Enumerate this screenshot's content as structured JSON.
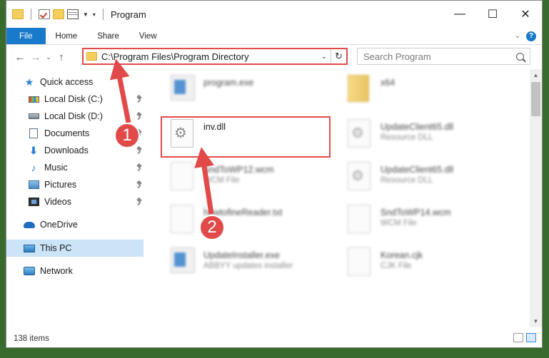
{
  "window": {
    "title": "Program",
    "controls": {
      "minimize": "—",
      "maximize": "☐",
      "close": "✕"
    }
  },
  "ribbon": {
    "tabs": [
      "File",
      "Home",
      "Share",
      "View"
    ],
    "help": "?"
  },
  "address": {
    "path": "C:\\Program Files\\Program Directory",
    "search_placeholder": "Search Program"
  },
  "nav": {
    "items": [
      {
        "label": "Quick access",
        "icon": "star-icon"
      },
      {
        "label": "Local Disk (C:)",
        "icon": "disk-icon",
        "pinned": true
      },
      {
        "label": "Local Disk (D:)",
        "icon": "disk-icon",
        "pinned": true
      },
      {
        "label": "Documents",
        "icon": "documents-icon",
        "pinned": true
      },
      {
        "label": "Downloads",
        "icon": "downloads-icon",
        "pinned": true
      },
      {
        "label": "Music",
        "icon": "music-icon",
        "pinned": true
      },
      {
        "label": "Pictures",
        "icon": "pictures-icon",
        "pinned": true
      },
      {
        "label": "Videos",
        "icon": "videos-icon",
        "pinned": true
      },
      {
        "label": "OneDrive",
        "icon": "onedrive-icon"
      },
      {
        "label": "This PC",
        "icon": "pc-icon",
        "selected": true
      },
      {
        "label": "Network",
        "icon": "network-icon"
      }
    ]
  },
  "files": [
    {
      "name": "program.exe",
      "type": "",
      "icon": "exe-icon"
    },
    {
      "name": "x64",
      "type": "",
      "icon": "folder-icon"
    },
    {
      "name": "inv.dll",
      "type": "",
      "icon": "dll-gear-icon"
    },
    {
      "name": "UpdateClient65.dll",
      "type": "Resource DLL",
      "icon": "dll-gear-icon"
    },
    {
      "name": "SndToWP12.wcm",
      "type": "WCM File",
      "icon": "document-icon"
    },
    {
      "name": "UpdateClient65.dll",
      "type": "Resource DLL",
      "icon": "dll-gear-icon"
    },
    {
      "name": "howtofineReader.txt",
      "type": "",
      "icon": "document-icon"
    },
    {
      "name": "SndToWP14.wcm",
      "type": "WCM File",
      "icon": "document-icon"
    },
    {
      "name": "UpdateInstaller.exe",
      "type": "ABBYY updates installer",
      "icon": "exe-icon"
    },
    {
      "name": "Korean.cjk",
      "type": "CJK File",
      "icon": "document-icon"
    }
  ],
  "status": {
    "item_count": "138 items"
  },
  "annotations": {
    "callout_1": "1",
    "callout_2": "2"
  },
  "colors": {
    "accent": "#1979ca",
    "highlight": "#e24a4a",
    "selected": "#cce4f7"
  }
}
